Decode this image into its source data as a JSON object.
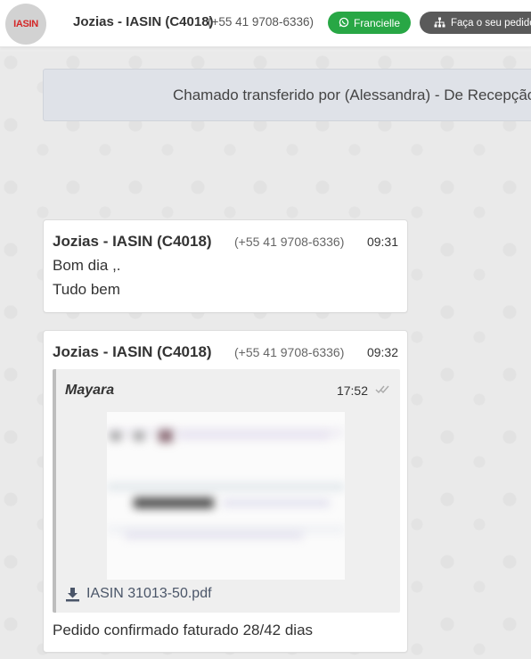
{
  "header": {
    "avatar_logo": "IASIN",
    "title": "Jozias - IASIN (C4018)",
    "phone": "(+55 41 9708-6336)",
    "agent_button": "Francielle",
    "order_button": "Faça o seu pedido"
  },
  "transfer_banner": {
    "text": "Chamado transferido por (Alessandra) - De Recepção"
  },
  "messages": [
    {
      "sender": "Jozias - IASIN (C4018)",
      "phone": "(+55 41 9708-6336)",
      "time": "09:31",
      "lines": [
        "Bom dia ,.",
        "Tudo bem"
      ]
    },
    {
      "sender": "Jozias - IASIN (C4018)",
      "phone": "(+55 41 9708-6336)",
      "time": "09:32",
      "quote": {
        "author": "Mayara",
        "time": "17:52",
        "attachment": "IASIN 31013-50.pdf"
      },
      "text": "Pedido confirmado faturado 28/42 dias"
    }
  ],
  "colors": {
    "agent_button": "#28a745",
    "order_button": "#5a5a5a",
    "banner_bg": "#dfe2e8",
    "logo_red": "#d42727"
  },
  "icons": {
    "agent_button": "whatsapp-icon",
    "order_button": "sitemap-icon",
    "attachment": "download-icon",
    "read_status": "double-check-icon"
  }
}
